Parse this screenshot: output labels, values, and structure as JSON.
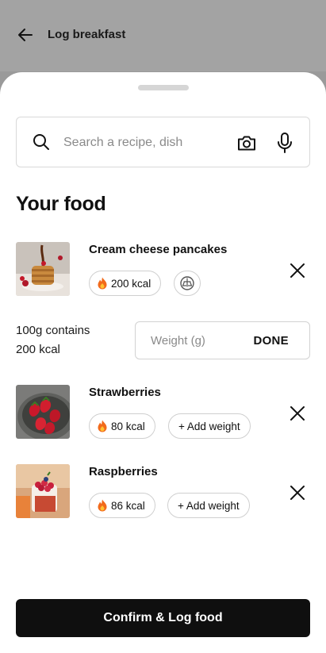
{
  "header": {
    "title": "Log breakfast",
    "back_icon": "arrow-left-icon"
  },
  "search": {
    "placeholder": "Search a recipe, dish",
    "value": ""
  },
  "section_title": "Your food",
  "foods": [
    {
      "name": "Cream cheese pancakes",
      "kcal": "200 kcal",
      "image": "pancakes-photo"
    },
    {
      "name": "Strawberries",
      "kcal": "80 kcal",
      "add_weight": "+ Add weight",
      "image": "strawberries-photo"
    },
    {
      "name": "Raspberries",
      "kcal": "86 kcal",
      "add_weight": "+ Add weight",
      "image": "raspberries-photo"
    }
  ],
  "weight_editor": {
    "contains_line1": "100g contains",
    "contains_line2": "200 kcal",
    "placeholder": "Weight (g)",
    "done_label": "DONE"
  },
  "confirm_label": "Confirm & Log food",
  "colors": {
    "primary": "#0f0f0f",
    "overlay": "#a3a3a3",
    "border": "#d9d9d9"
  }
}
